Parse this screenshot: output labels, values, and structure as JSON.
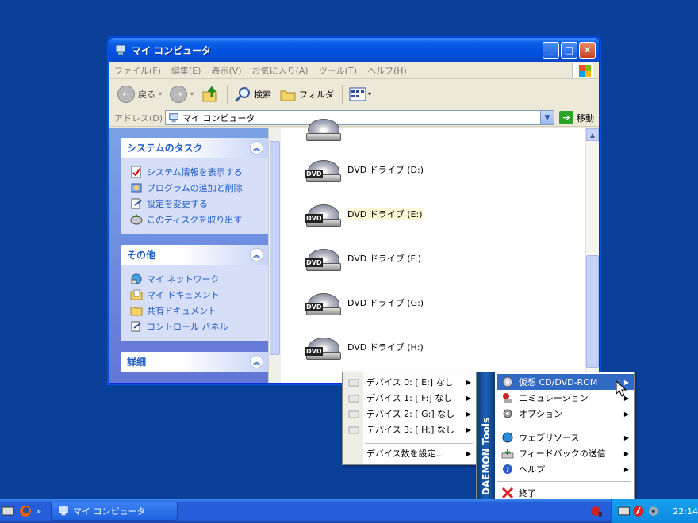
{
  "window": {
    "title": "マイ コンピュータ",
    "buttons": {
      "minimize": "_",
      "maximize": "□",
      "close": "✕"
    }
  },
  "menubar": [
    "ファイル(F)",
    "編集(E)",
    "表示(V)",
    "お気に入り(A)",
    "ツール(T)",
    "ヘルプ(H)"
  ],
  "toolbar": {
    "back": "戻る",
    "search": "検索",
    "folders": "フォルダ"
  },
  "address": {
    "label": "アドレス(D)",
    "value": "マイ コンピュータ",
    "go": "移動"
  },
  "left_panels": [
    {
      "title": "システムのタスク",
      "links": [
        "システム情報を表示する",
        "プログラムの追加と削除",
        "設定を変更する",
        "このディスクを取り出す"
      ]
    },
    {
      "title": "その他",
      "links": [
        "マイ ネットワーク",
        "マイ ドキュメント",
        "共有ドキュメント",
        "コントロール パネル"
      ]
    },
    {
      "title": "詳細",
      "links": []
    }
  ],
  "drives": [
    {
      "name": "DVD ドライブ (D:)",
      "selected": false
    },
    {
      "name": "DVD ドライブ (E:)",
      "selected": true
    },
    {
      "name": "DVD ドライブ (F:)",
      "selected": false
    },
    {
      "name": "DVD ドライブ (G:)",
      "selected": false
    },
    {
      "name": "DVD ドライブ (H:)",
      "selected": false
    }
  ],
  "drive_badge": "DVD",
  "device_submenu": {
    "items": [
      "デバイス 0: [ E:] なし",
      "デバイス 1: [ F:] なし",
      "デバイス 2: [ G:] なし",
      "デバイス 3: [ H:] なし"
    ],
    "set_count": "デバイス数を設定..."
  },
  "daemon_menu": {
    "brand": "DAEMON Tools",
    "items": [
      "仮想 CD/DVD-ROM",
      "エミュレーション",
      "オプション",
      "ウェブリソース",
      "フィードバックの送信",
      "ヘルプ",
      "終了"
    ]
  },
  "taskbar": {
    "task": "マイ コンピュータ",
    "clock": "22:14"
  },
  "colors": {
    "desktop": "#0a3f9a",
    "taskbar": "#245edb",
    "menu_highlight": "#316ac5",
    "link": "#215dc6"
  }
}
